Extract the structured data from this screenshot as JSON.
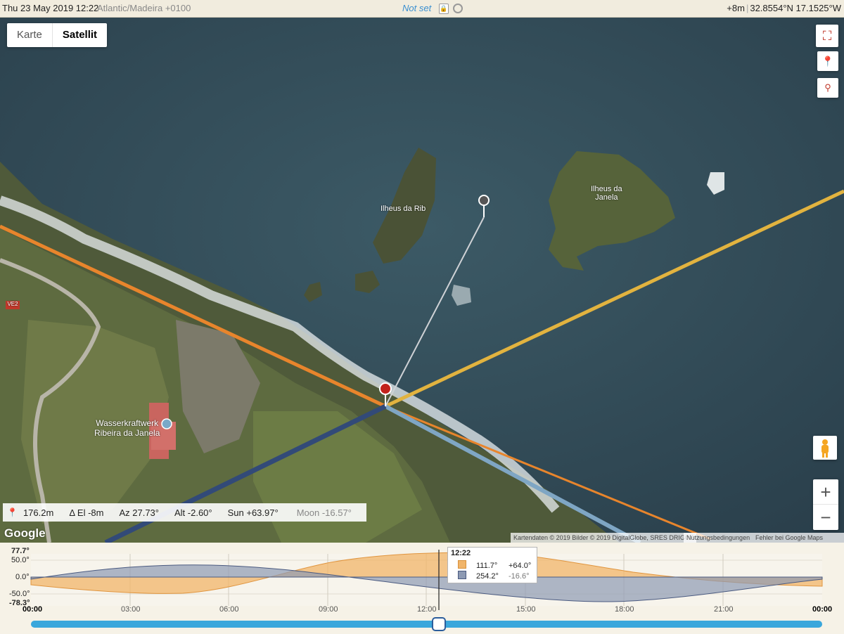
{
  "topbar": {
    "datetime": "Thu 23 May 2019 12:22",
    "timezone": "Atlantic/Madeira +0100",
    "status": "Not set",
    "elevation": "+8m",
    "coords": "32.8554°N 17.1525°W"
  },
  "map": {
    "type_buttons": [
      "Karte",
      "Satellit"
    ],
    "selected_type": "Satellit",
    "places": {
      "rib": "Ilheus da Rib",
      "janela_line1": "Ilheus da",
      "janela_line2": "Janela",
      "hydro_line1": "Wasserkraftwerk",
      "hydro_line2": "Ribeira da Janela",
      "road": "VE2"
    },
    "info": {
      "distance": "176.2m",
      "delta_el": "Δ El  -8m",
      "azimuth": "Az 27.73°",
      "altitude": "Alt  -2.60°",
      "sun": "Sun +63.97°",
      "moon": "Moon -16.57°"
    },
    "google_logo": "Google",
    "attribution": "Kartendaten © 2019 Bilder © 2019 DigitalGlobe, SRES DRIGOT",
    "terms": "Nutzungsbedingungen",
    "report": "Fehler bei Google Maps melden",
    "zoom_in": "+",
    "zoom_out": "−",
    "colors": {
      "sun_line": "#e2b33f",
      "sunset_line": "#e8852c",
      "moon_line": "#324a78",
      "moonset_line": "#7fa6c4"
    }
  },
  "timeline": {
    "ymax_label": "77.7°",
    "y50_label": "50.0°",
    "y0_label": "0.0°",
    "yneg50_label": "-50.0°",
    "ymin_label": "-78.3°",
    "hours": [
      "00:00",
      "03:00",
      "06:00",
      "09:00",
      "12:00",
      "15:00",
      "18:00",
      "21:00",
      "00:00"
    ],
    "current_time": "12:22",
    "sun_row": {
      "azimuth": "111.7°",
      "elevation": "+64.0°",
      "color": "#f1b56a"
    },
    "moon_row": {
      "azimuth": "254.2°",
      "elevation": "-16.6°",
      "color": "#8d9ab3"
    },
    "slider_fraction": 0.5153
  }
}
